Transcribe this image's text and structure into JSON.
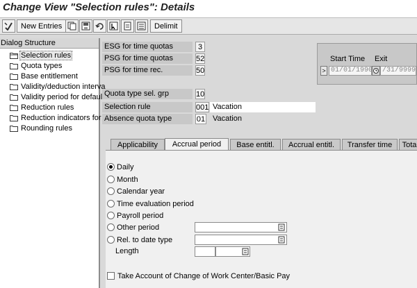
{
  "window": {
    "title": "Change View \"Selection rules\": Details"
  },
  "toolbar": {
    "new_entries_label": "New Entries",
    "delimit_label": "Delimit"
  },
  "dialog_structure": {
    "header": "Dialog Structure",
    "items": [
      {
        "label": "Selection rules",
        "selected": true
      },
      {
        "label": "Quota types"
      },
      {
        "label": "Base entitlement"
      },
      {
        "label": "Validity/deduction interva"
      },
      {
        "label": "Validity period for default"
      },
      {
        "label": "Reduction rules"
      },
      {
        "label": "Reduction indicators for"
      },
      {
        "label": "Rounding rules"
      }
    ]
  },
  "fields": {
    "esg_label": "ESG for time quotas",
    "esg_value": "3",
    "psg_quota_label": "PSG for time quotas",
    "psg_quota_value": "52",
    "psg_rec_label": "PSG for time rec.",
    "psg_rec_value": "50",
    "quota_grp_label": "Quota type sel. grp",
    "quota_grp_value": "10",
    "selection_rule_label": "Selection rule",
    "selection_rule_value": "001",
    "selection_rule_text": "Vacation",
    "absence_quota_label": "Absence quota type",
    "absence_quota_value": "01",
    "absence_quota_text": "Vacation"
  },
  "validity": {
    "start_label": "Start Time",
    "exit_label": "Exit",
    "start_value": "01/01/1990",
    "end_value": "/31/9999"
  },
  "tabs": [
    {
      "label": "Applicability"
    },
    {
      "label": "Accrual period",
      "active": true
    },
    {
      "label": "Base entitl."
    },
    {
      "label": "Accrual entitl."
    },
    {
      "label": "Transfer time"
    },
    {
      "label": "Tota"
    }
  ],
  "accrual_period": {
    "options": [
      {
        "label": "Daily",
        "selected": true
      },
      {
        "label": "Month"
      },
      {
        "label": "Calendar year"
      },
      {
        "label": "Time evaluation period"
      },
      {
        "label": "Payroll period"
      },
      {
        "label": "Other period"
      },
      {
        "label": "Rel. to date type"
      }
    ],
    "length_label": "Length",
    "other_period_value": "",
    "rel_date_value": "",
    "length_value": "",
    "length_unit": "",
    "checkbox_label": "Take Account of Change of Work Center/Basic Pay"
  },
  "icons": [
    "check-icon",
    "copy-icon",
    "save-icon",
    "undo-icon",
    "select-icon",
    "document-icon",
    "list-icon",
    "folder-icon",
    "f4-help-icon"
  ]
}
